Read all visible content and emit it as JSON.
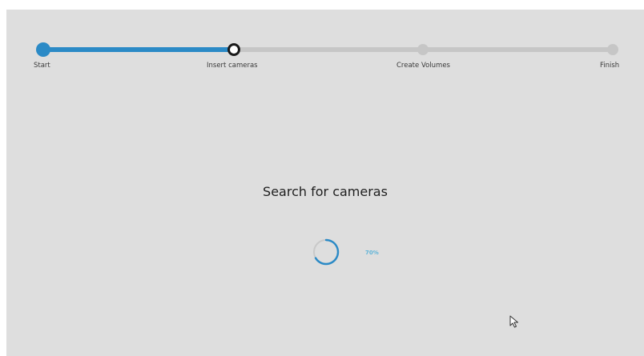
{
  "wizard": {
    "steps": [
      {
        "label": "Start",
        "state": "done"
      },
      {
        "label": "Insert cameras",
        "state": "current"
      },
      {
        "label": "Create Volumes",
        "state": "pending"
      },
      {
        "label": "Finish",
        "state": "pending"
      }
    ],
    "progress_fraction": 0.337,
    "accent_color": "#2b8ac6"
  },
  "search": {
    "title": "Search for cameras",
    "progress_text": "70%",
    "spinner_icon": "loading-spinner-icon"
  },
  "cursor_icon": "mouse-pointer-icon"
}
